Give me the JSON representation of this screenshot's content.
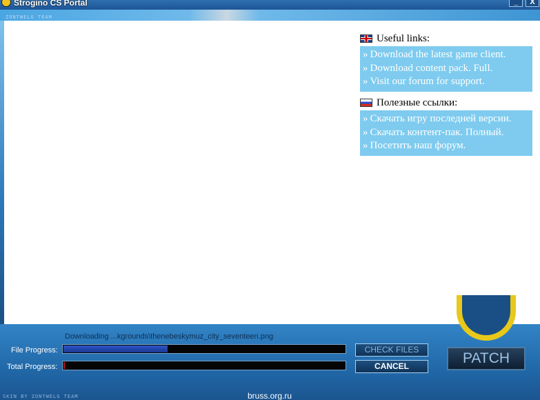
{
  "window": {
    "title": "Strogino CS Portal",
    "minimize_label": "_",
    "close_label": "X"
  },
  "decor": {
    "skin_credit_top": "ZONTWELG TEAM",
    "skin_credit_bottom": "SKIN BY ZONTWELG TEAM",
    "site": "bruss.org.ru"
  },
  "links_en": {
    "heading": "Useful links:",
    "flag_icon": "uk-flag-icon",
    "items": [
      {
        "arrow": "»",
        "label": "Download the latest game client."
      },
      {
        "arrow": "»",
        "label": "Download content pack. Full."
      },
      {
        "arrow": "»",
        "label": "Visit our forum for support."
      }
    ]
  },
  "links_ru": {
    "heading": "Полезные ссылки:",
    "flag_icon": "russia-flag-icon",
    "items": [
      {
        "arrow": "»",
        "label": "Скачать игру последней версии."
      },
      {
        "arrow": "»",
        "label": "Скачать контент-пак. Полный."
      },
      {
        "arrow": "»",
        "label": "Посетить наш форум."
      }
    ]
  },
  "status": {
    "text": "Downloading ...kgrounds\\thenebeskymuz_city_seventeen.png"
  },
  "progress": {
    "file_label": "File Progress:",
    "file_value": 0.37,
    "total_label": "Total Progress:",
    "total_value": 0.005
  },
  "buttons": {
    "check_files": "CHECK FILES",
    "cancel": "CANCEL",
    "patch": "PATCH"
  },
  "colors": {
    "links_box": "#7ecbef",
    "file_fill": "#2e54c9",
    "total_fill": "#c81414"
  }
}
